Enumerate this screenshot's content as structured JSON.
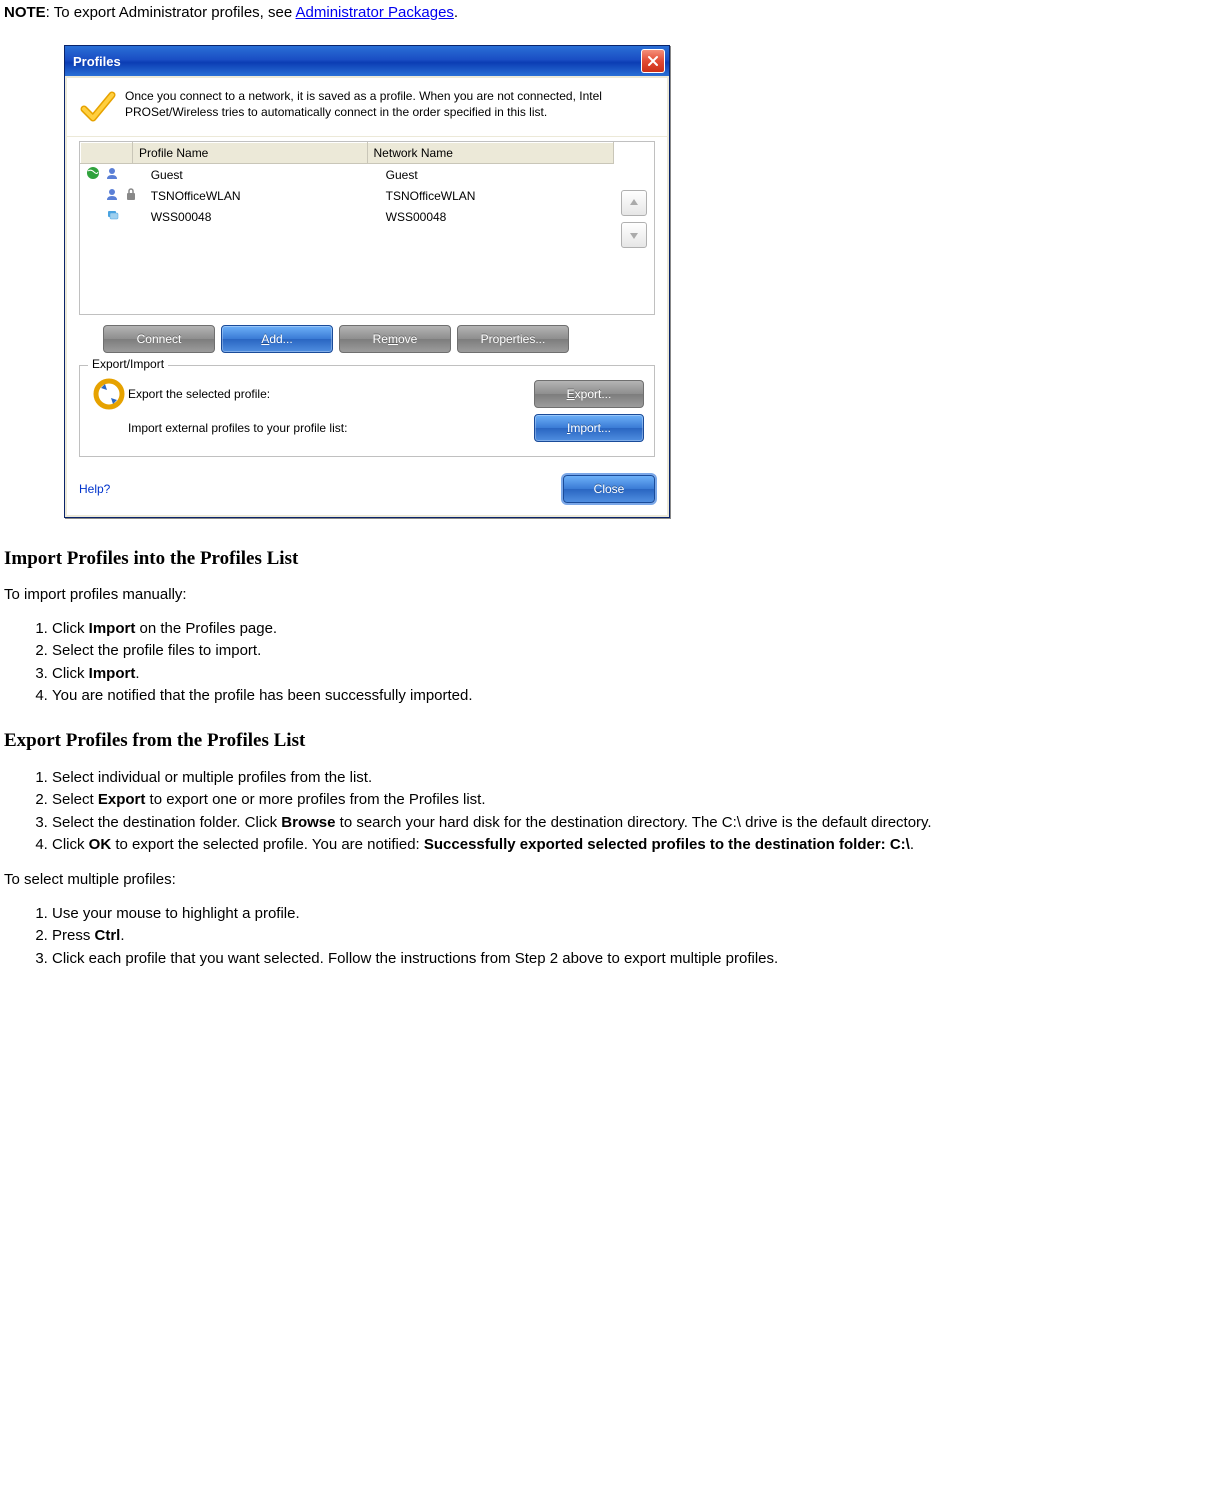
{
  "note": {
    "label": "NOTE",
    "text_before": ": To export Administrator profiles, see ",
    "link": "Administrator Packages",
    "text_after": "."
  },
  "dialog": {
    "title": "Profiles",
    "intro": "Once you connect to a network, it is saved as a profile. When you are not connected, Intel PROSet/Wireless tries to automatically connect in the order specified in this list.",
    "columns": {
      "c1": "",
      "c2": "Profile Name",
      "c3": "Network Name"
    },
    "rows": [
      {
        "icons": "globe,user",
        "profile": "Guest",
        "network": "Guest"
      },
      {
        "icons": "user,lock",
        "profile": "TSNOfficeWLAN",
        "network": "TSNOfficeWLAN"
      },
      {
        "icons": "cards",
        "profile": "WSS00048",
        "network": "WSS00048"
      }
    ],
    "buttons": {
      "connect": "Connect",
      "add": "Add...",
      "remove": "Remove",
      "properties": "Properties..."
    },
    "export_import": {
      "legend": "Export/Import",
      "export_label": "Export the selected profile:",
      "import_label": "Import external profiles to your profile list:",
      "export_btn": "Export...",
      "import_btn": "Import..."
    },
    "help": "Help?",
    "close": "Close"
  },
  "sections": {
    "import_heading": "Import Profiles into the Profiles List",
    "import_intro": "To import profiles manually:",
    "import_steps": {
      "s1_a": "Click ",
      "s1_b": "Import",
      "s1_c": " on the Profiles page.",
      "s2": "Select the profile files to import.",
      "s3_a": "Click ",
      "s3_b": "Import",
      "s3_c": ".",
      "s4": "You are notified that the profile has been successfully imported."
    },
    "export_heading": "Export Profiles from the Profiles List",
    "export_steps": {
      "s1": "Select individual or multiple profiles from the list.",
      "s2_a": "Select ",
      "s2_b": "Export",
      "s2_c": " to export one or more profiles from the Profiles list.",
      "s3_a": "Select the destination folder. Click ",
      "s3_b": "Browse",
      "s3_c": " to search your hard disk for the destination directory. The C:\\ drive is the default directory.",
      "s4_a": "Click ",
      "s4_b": "OK",
      "s4_c": " to export the selected profile. You are notified: ",
      "s4_d": "Successfully exported selected profiles to the destination folder: C:\\",
      "s4_e": "."
    },
    "multi_intro": "To select multiple profiles:",
    "multi_steps": {
      "s1": "Use your mouse to highlight a profile.",
      "s2_a": "Press ",
      "s2_b": "Ctrl",
      "s2_c": ".",
      "s3": "Click each profile that you want selected. Follow the instructions from Step 2 above to export multiple profiles."
    }
  }
}
